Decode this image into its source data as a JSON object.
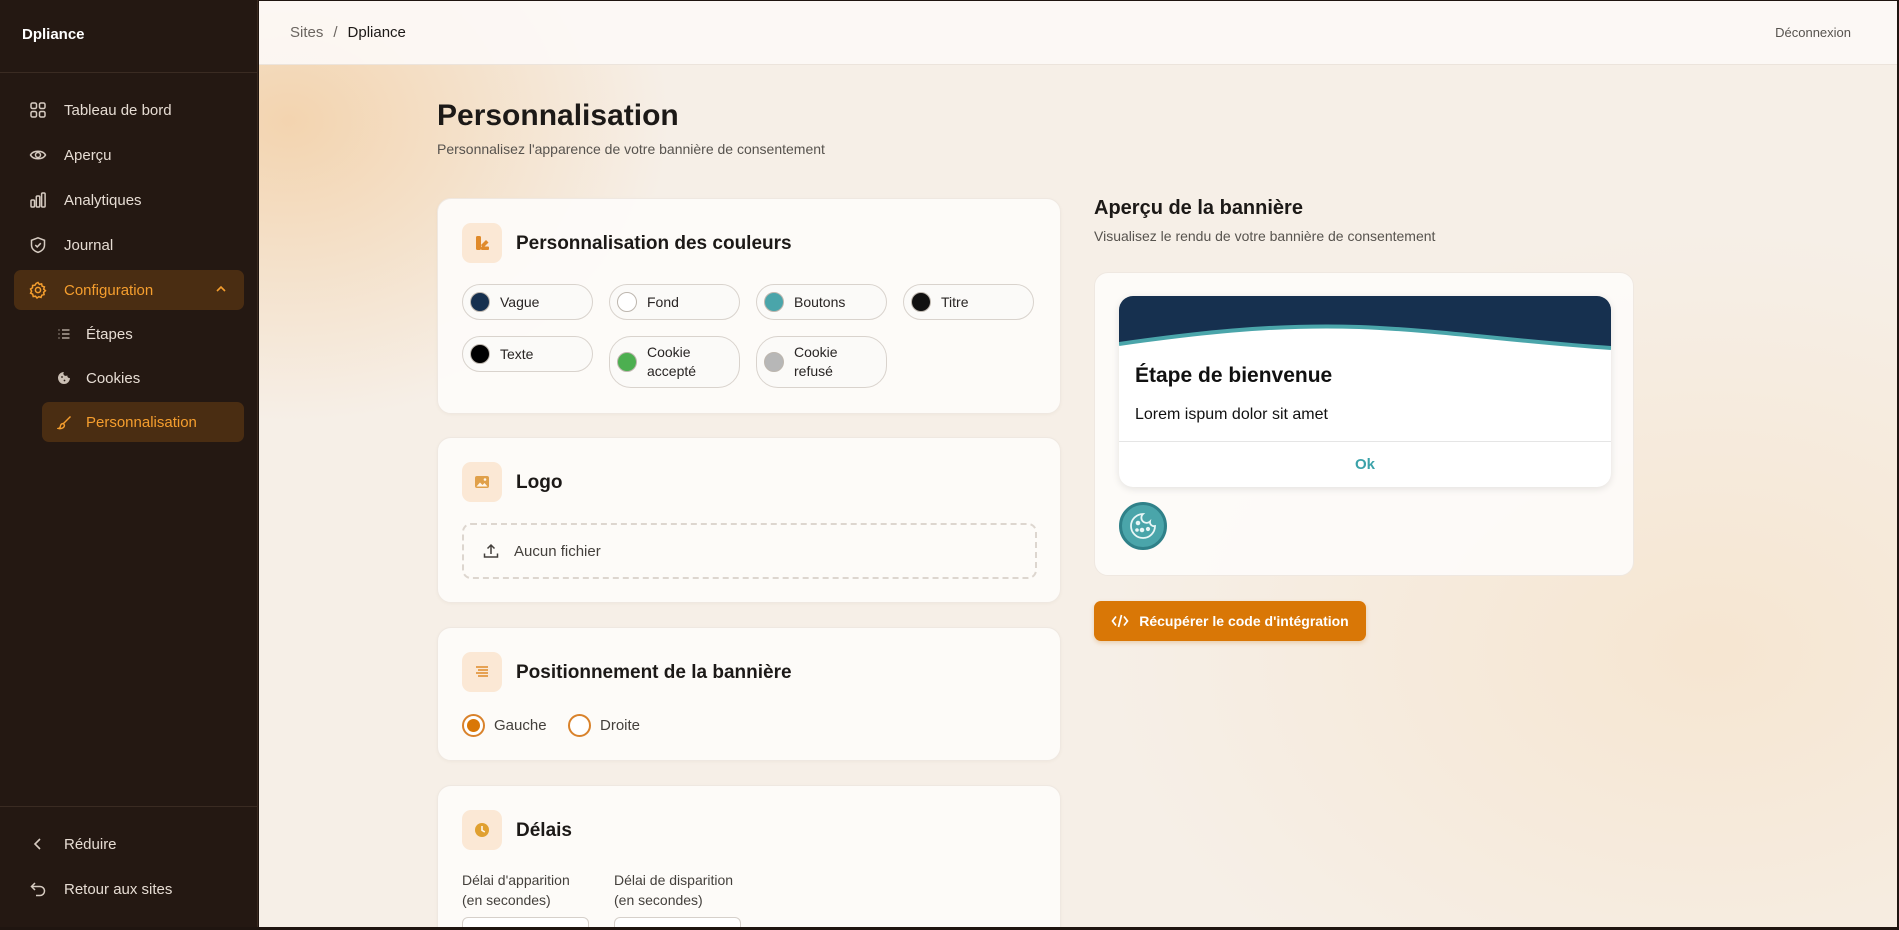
{
  "app": {
    "brand": "Dpliance"
  },
  "sidebar": {
    "items": [
      {
        "label": "Tableau de bord",
        "icon": "dashboard-icon"
      },
      {
        "label": "Aperçu",
        "icon": "eye-icon"
      },
      {
        "label": "Analytiques",
        "icon": "bar-chart-icon"
      },
      {
        "label": "Journal",
        "icon": "shield-icon"
      },
      {
        "label": "Configuration",
        "icon": "gear-icon",
        "active": true,
        "expanded": true
      }
    ],
    "subitems": [
      {
        "label": "Étapes",
        "icon": "list-icon"
      },
      {
        "label": "Cookies",
        "icon": "cookie-icon"
      },
      {
        "label": "Personnalisation",
        "icon": "brush-icon",
        "active": true
      }
    ],
    "bottom": {
      "collapse_label": "Réduire",
      "back_label": "Retour aux sites"
    }
  },
  "topbar": {
    "breadcrumb": [
      "Sites",
      "/",
      "Dpliance"
    ],
    "logout_label": "Déconnexion"
  },
  "page": {
    "title": "Personnalisation",
    "subtitle": "Personnalisez l'apparence de votre bannière de consentement"
  },
  "colors_card": {
    "title": "Personnalisation des couleurs",
    "swatches": [
      {
        "label": "Vague",
        "color": "#16304f"
      },
      {
        "label": "Fond",
        "color": "#ffffff"
      },
      {
        "label": "Boutons",
        "color": "#4aa5aa"
      },
      {
        "label": "Titre",
        "color": "#111111"
      },
      {
        "label": "Texte",
        "color": "#000000"
      },
      {
        "label": "Cookie accepté",
        "color": "#4caf50"
      },
      {
        "label": "Cookie refusé",
        "color": "#b7b7b7"
      }
    ]
  },
  "logo_card": {
    "title": "Logo",
    "file_label": "Aucun fichier"
  },
  "position_card": {
    "title": "Positionnement de la bannière",
    "options": [
      {
        "label": "Gauche",
        "selected": true
      },
      {
        "label": "Droite",
        "selected": false
      }
    ]
  },
  "delays_card": {
    "title": "Délais",
    "appear_label_1": "Délai d'apparition",
    "appear_label_2": "(en secondes)",
    "disappear_label_1": "Délai de disparition",
    "disappear_label_2": "(en secondes)"
  },
  "preview": {
    "title": "Aperçu de la bannière",
    "subtitle": "Visualisez le rendu de votre bannière de consentement",
    "banner_title": "Étape de bienvenue",
    "banner_text": "Lorem ispum dolor sit amet",
    "ok_label": "Ok",
    "wave_color": "#16304f",
    "accent_color": "#4aa5aa"
  },
  "embed_button": {
    "label": "Récupérer le code d'intégration"
  },
  "theme": {
    "accent": "#d97706",
    "sidebar_bg": "#241812"
  }
}
